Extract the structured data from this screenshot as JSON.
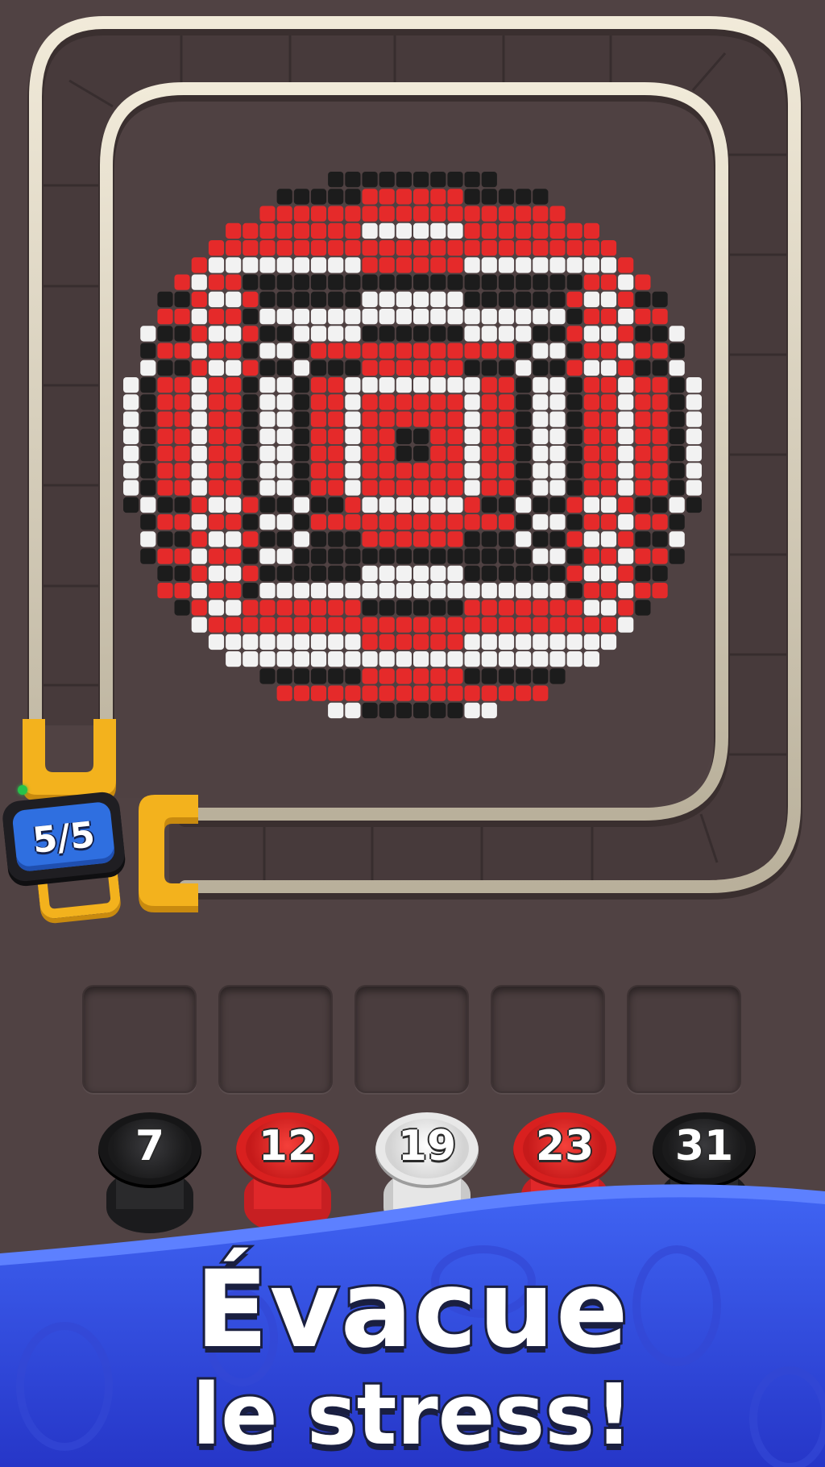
{
  "counter": {
    "label": "5/5"
  },
  "spools": [
    {
      "number": "7",
      "color": "black"
    },
    {
      "number": "12",
      "color": "red"
    },
    {
      "number": "19",
      "color": "white"
    },
    {
      "number": "23",
      "color": "red"
    },
    {
      "number": "31",
      "color": "black"
    }
  ],
  "slots": {
    "count": 5,
    "state": "empty"
  },
  "pattern": {
    "palette": {
      "red": "#e52a2a",
      "white": "#f2f2f2",
      "black": "#1c1c1c"
    }
  },
  "promo": {
    "line1": "Évacue",
    "line2": "le stress!"
  },
  "colors": {
    "background": "#504243",
    "rail": "#d8d1be",
    "clip": "#f3b21d",
    "counter_blue": "#2f6fe0",
    "banner_blue": "#2d4ae6"
  }
}
